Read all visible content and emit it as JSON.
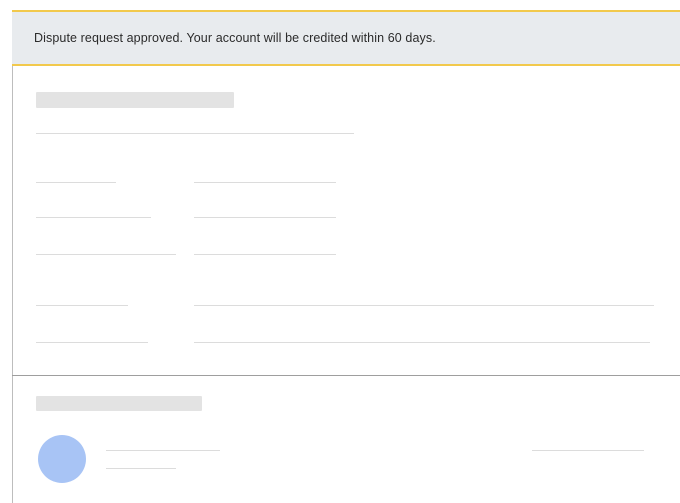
{
  "alert": {
    "message": "Dispute request approved. Your account will be credited within 60 days.",
    "accent_color": "#f2c94c",
    "background_color": "#e8ebee"
  },
  "placeholders": {
    "skeleton_color": "#e3e3e3",
    "avatar_color": "#a8c4f5"
  }
}
